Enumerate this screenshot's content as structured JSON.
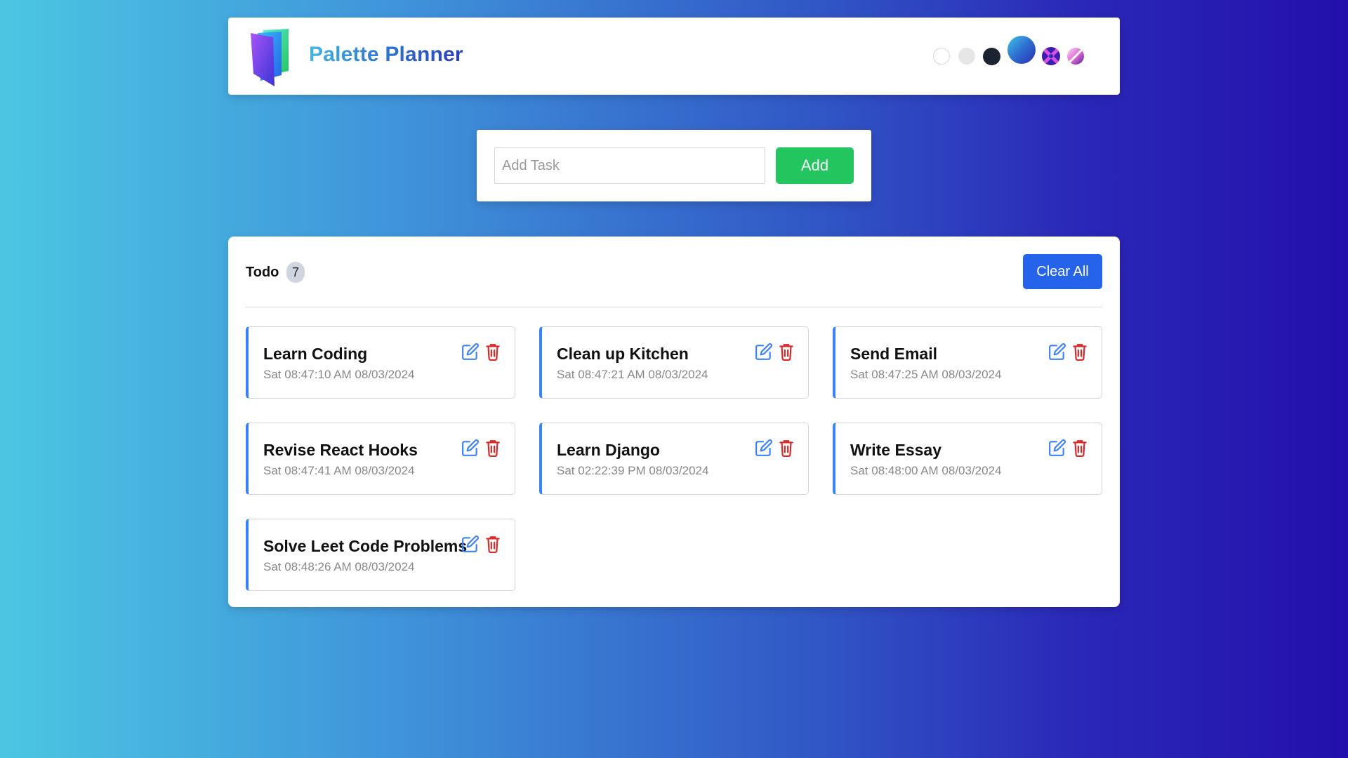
{
  "header": {
    "brand": "Palette Planner",
    "logo_icon": "folder-book-icon",
    "themes": [
      {
        "name": "white-theme-swatch",
        "color": "#ffffff"
      },
      {
        "name": "light-theme-swatch",
        "color": "#e6e6e6"
      },
      {
        "name": "dark-theme-swatch",
        "color": "#1b2230"
      },
      {
        "name": "ocean-gradient-theme-swatch",
        "color": "#2d6ed0",
        "selected": true
      },
      {
        "name": "purple-x-theme-swatch",
        "color": "#3a1fae"
      },
      {
        "name": "pink-gradient-theme-swatch",
        "color": "#e070d6"
      }
    ]
  },
  "add_task": {
    "placeholder": "Add Task",
    "value": "",
    "button_label": "Add",
    "button_color": "#22c55e"
  },
  "todo": {
    "title": "Todo",
    "count": "7",
    "clear_label": "Clear All",
    "clear_color": "#2563eb",
    "accent_color": "#3b82f6",
    "edit_icon": "edit-icon",
    "delete_icon": "trash-icon",
    "tasks": [
      {
        "name": "Learn Coding",
        "time": "Sat 08:47:10 AM 08/03/2024"
      },
      {
        "name": "Clean up Kitchen",
        "time": "Sat 08:47:21 AM 08/03/2024"
      },
      {
        "name": "Send Email",
        "time": "Sat 08:47:25 AM 08/03/2024"
      },
      {
        "name": "Revise React Hooks",
        "time": "Sat 08:47:41 AM 08/03/2024"
      },
      {
        "name": "Learn Django",
        "time": "Sat 02:22:39 PM 08/03/2024"
      },
      {
        "name": "Write Essay",
        "time": "Sat 08:48:00 AM 08/03/2024"
      },
      {
        "name": "Solve Leet Code Problems",
        "time": "Sat 08:48:26 AM 08/03/2024"
      }
    ]
  }
}
